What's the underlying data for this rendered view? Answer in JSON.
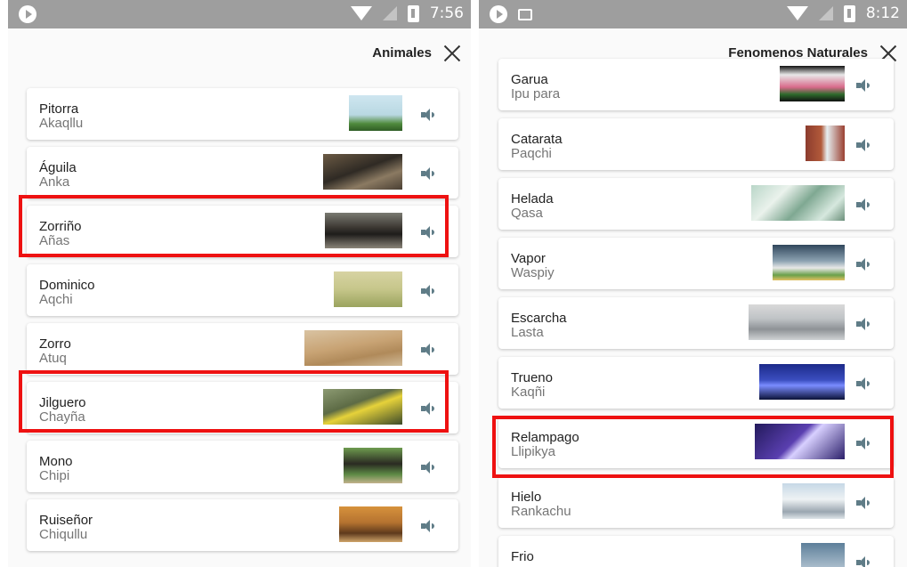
{
  "left_screen": {
    "status": {
      "time": "7:56"
    },
    "title": "Animales",
    "items": [
      {
        "name": "Pitorra",
        "translation": "Akaqllu",
        "image": "bird-on-post photo"
      },
      {
        "name": "Águila",
        "translation": "Anka",
        "image": "eagle photo"
      },
      {
        "name": "Zorriño",
        "translation": "Añas",
        "image": "skunk photo",
        "highlighted": true
      },
      {
        "name": "Dominico",
        "translation": "Aqchi",
        "image": "black bird photo"
      },
      {
        "name": "Zorro",
        "translation": "Atuq",
        "image": "fox photo"
      },
      {
        "name": "Jilguero",
        "translation": "Chayña",
        "image": "goldfinch photo",
        "highlighted": true
      },
      {
        "name": "Mono",
        "translation": "Chipi",
        "image": "monkey photo"
      },
      {
        "name": "Ruiseñor",
        "translation": "Chiqullu",
        "image": "nightingale photo"
      }
    ]
  },
  "right_screen": {
    "status": {
      "time": "8:12"
    },
    "title": "Fenomenos Naturales",
    "items": [
      {
        "name": "Garua",
        "translation": "Ipu para",
        "image": "drizzle on flowers photo"
      },
      {
        "name": "Catarata",
        "translation": "Paqchi",
        "image": "waterfall photo"
      },
      {
        "name": "Helada",
        "translation": "Qasa",
        "image": "frosted leaves photo"
      },
      {
        "name": "Vapor",
        "translation": "Waspiy",
        "image": "steaming food photo"
      },
      {
        "name": "Escarcha",
        "translation": "Lasta",
        "image": "frost landscape photo"
      },
      {
        "name": "Trueno",
        "translation": "Kaqñi",
        "image": "thunderstorm photo"
      },
      {
        "name": "Relampago",
        "translation": "Llipikya",
        "image": "lightning photo",
        "highlighted": true
      },
      {
        "name": "Hielo",
        "translation": "Rankachu",
        "image": "icy street photo"
      },
      {
        "name": "Frio",
        "translation": "",
        "image": "cold scene photo"
      }
    ]
  },
  "colors": {
    "highlight": "#ee1111",
    "speaker": "#5f7c87",
    "statusbar": "#9e9e9e"
  },
  "icons": [
    "play-icon",
    "image-icon",
    "wifi-icon",
    "signal-icon",
    "battery-icon",
    "close-icon",
    "speaker-icon"
  ]
}
